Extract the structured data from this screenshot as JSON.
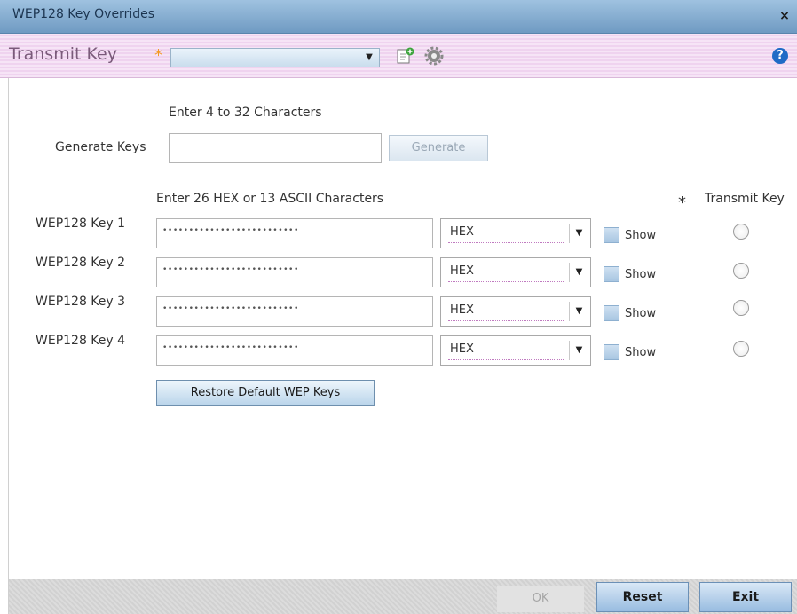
{
  "window": {
    "title": "WEP128 Key Overrides",
    "close_glyph": "×"
  },
  "toolbar": {
    "label": "Transmit Key",
    "required_mark": "*",
    "combo_value": "",
    "icons": [
      "new-item-icon",
      "settings-icon",
      "help-icon"
    ],
    "help_glyph": "?"
  },
  "generate": {
    "hint": "Enter 4 to 32 Characters",
    "label": "Generate Keys",
    "value": "",
    "button": "Generate"
  },
  "keys_section": {
    "hint": "Enter 26 HEX or 13 ASCII Characters",
    "transmit_header": "Transmit Key",
    "required_mark": "*",
    "rows": [
      {
        "label": "WEP128 Key 1",
        "masked": "••••••••••••••••••••••••••",
        "format": "HEX",
        "show": "Show",
        "show_checked": false,
        "transmit_selected": false
      },
      {
        "label": "WEP128 Key 2",
        "masked": "••••••••••••••••••••••••••",
        "format": "HEX",
        "show": "Show",
        "show_checked": false,
        "transmit_selected": false
      },
      {
        "label": "WEP128 Key 3",
        "masked": "••••••••••••••••••••••••••",
        "format": "HEX",
        "show": "Show",
        "show_checked": false,
        "transmit_selected": false
      },
      {
        "label": "WEP128 Key 4",
        "masked": "••••••••••••••••••••••••••",
        "format": "HEX",
        "show": "Show",
        "show_checked": false,
        "transmit_selected": false
      }
    ],
    "restore_button": "Restore Default WEP Keys"
  },
  "footer": {
    "ok": "OK",
    "reset": "Reset",
    "exit": "Exit"
  },
  "colors": {
    "title_bar": "#8fb4d8",
    "toolbar": "#f3dcf3",
    "required": "#f49a20",
    "button": "#b9d4ea"
  },
  "icons": {
    "close": "close-icon",
    "dropdown": "chevron-down-icon",
    "new": "new-item-icon",
    "settings": "settings-icon",
    "help": "help-icon",
    "required": "required-star-icon"
  }
}
